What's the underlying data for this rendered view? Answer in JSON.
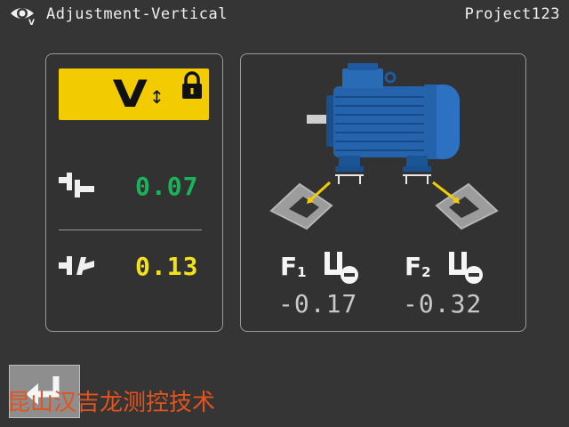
{
  "header": {
    "title": "Adjustment-Vertical",
    "project": "Project123",
    "logo_icon": "eye-v-logo-icon"
  },
  "left_panel": {
    "mode": {
      "letter": "V",
      "arrow": "↕",
      "lock_icon": "lock-icon",
      "background": "#f2cc00"
    },
    "offset": {
      "icon": "parallel-offset-icon",
      "value": "0.07",
      "color": "#19b35a"
    },
    "angle": {
      "icon": "angular-offset-icon",
      "value": "0.13",
      "color": "#f3e21a"
    }
  },
  "right_panel": {
    "motor_icon": "electric-motor-icon",
    "motor_color": "#1f5fa8",
    "feet": [
      {
        "label": "F",
        "sub": "1",
        "shim_icon": "remove-shim-icon",
        "value": "-0.17"
      },
      {
        "label": "F",
        "sub": "2",
        "shim_icon": "remove-shim-icon",
        "value": "-0.32"
      }
    ]
  },
  "footer": {
    "back_icon": "enter-back-icon",
    "watermark": "昆山汉吉龙测控技术"
  }
}
